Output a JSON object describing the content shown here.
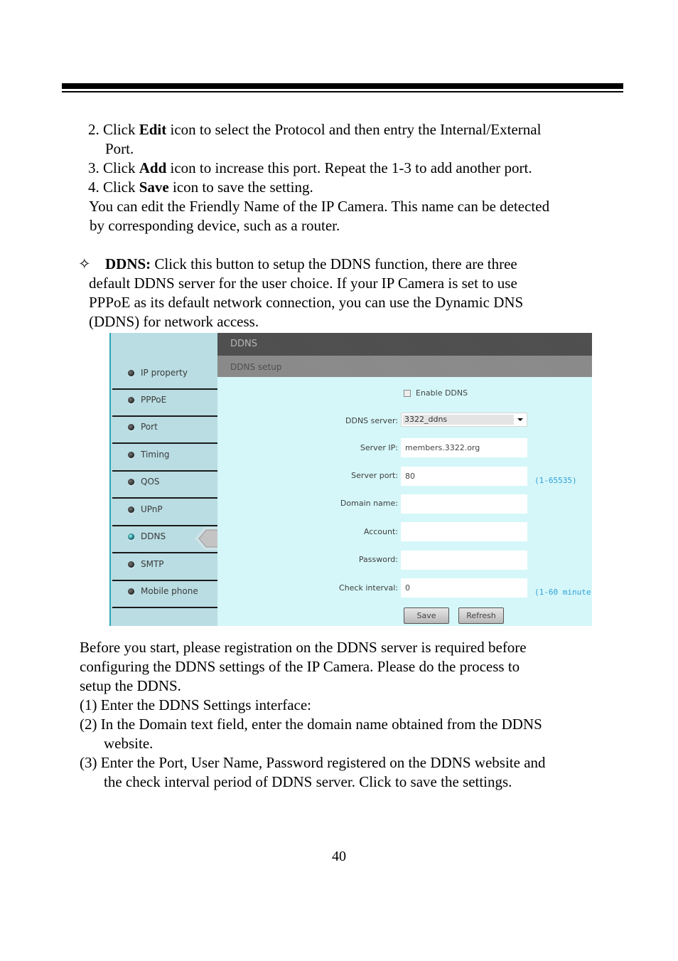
{
  "intro_steps": [
    {
      "prefix": "2. Click ",
      "bold": "Edit",
      "suffix": " icon to select the Protocol and then entry the Internal/External"
    },
    {
      "continuation": "Port."
    },
    {
      "prefix": "3. Click ",
      "bold": "Add",
      "suffix": " icon to increase this port.    Repeat the 1-3 to add another port."
    },
    {
      "prefix": "4. Click ",
      "bold": "Save",
      "suffix": " icon to save the setting."
    }
  ],
  "friendly_name_note": [
    "You can edit the Friendly Name of the IP Camera. This name can be detected",
    "by corresponding device, such as a router."
  ],
  "ddns_section": {
    "bullet": "✧",
    "title": "DDNS:",
    "lines": [
      " Click this button to setup the DDNS function, there are three",
      "default DDNS server for the user choice.    If your IP Camera is set to use",
      "PPPoE as its default network connection, you can use the Dynamic DNS",
      "(DDNS) for network access."
    ]
  },
  "screenshot": {
    "sidebar": {
      "items": [
        {
          "label": "IP property",
          "active": false
        },
        {
          "label": "PPPoE",
          "active": false
        },
        {
          "label": "Port",
          "active": false
        },
        {
          "label": "Timing",
          "active": false
        },
        {
          "label": "QOS",
          "active": false
        },
        {
          "label": "UPnP",
          "active": false
        },
        {
          "label": "DDNS",
          "active": true
        },
        {
          "label": "SMTP",
          "active": false
        },
        {
          "label": "Mobile phone",
          "active": false
        }
      ]
    },
    "header_title": "DDNS",
    "subheader_title": "DDNS setup",
    "enable_ddns": {
      "label": "Enable DDNS",
      "checked": false
    },
    "fields": {
      "ddns_server": {
        "label": "DDNS server:",
        "value": "3322_ddns"
      },
      "server_ip": {
        "label": "Server IP:",
        "value": "members.3322.org"
      },
      "server_port": {
        "label": "Server port:",
        "value": "80",
        "hint": "(1-65535)"
      },
      "domain_name": {
        "label": "Domain name:",
        "value": ""
      },
      "account": {
        "label": "Account:",
        "value": ""
      },
      "password": {
        "label": "Password:",
        "value": ""
      },
      "check_interval": {
        "label": "Check interval:",
        "value": "0",
        "hint": "(1-60 minute)"
      }
    },
    "buttons": {
      "save": "Save",
      "refresh": "Refresh"
    },
    "colors": {
      "sidebar_bg": "#b9dde3",
      "content_bg": "#d5f7f9",
      "hint": "#2fa0d8",
      "header_dark": "#4f4f4f",
      "header_mid": "#8a8a8a"
    }
  },
  "after_text": [
    "Before you start, please registration on the DDNS server is required before",
    "configuring the DDNS settings of the IP Camera.    Please do the process to",
    "setup the DDNS.",
    "(1) Enter the DDNS Settings interface:",
    "(2) In the Domain text field, enter the domain name obtained from the DDNS",
    "website.",
    "(3) Enter the Port, User Name, Password registered on the DDNS website and",
    "the check interval period of DDNS server.    Click to save the settings."
  ],
  "page_number": "40"
}
